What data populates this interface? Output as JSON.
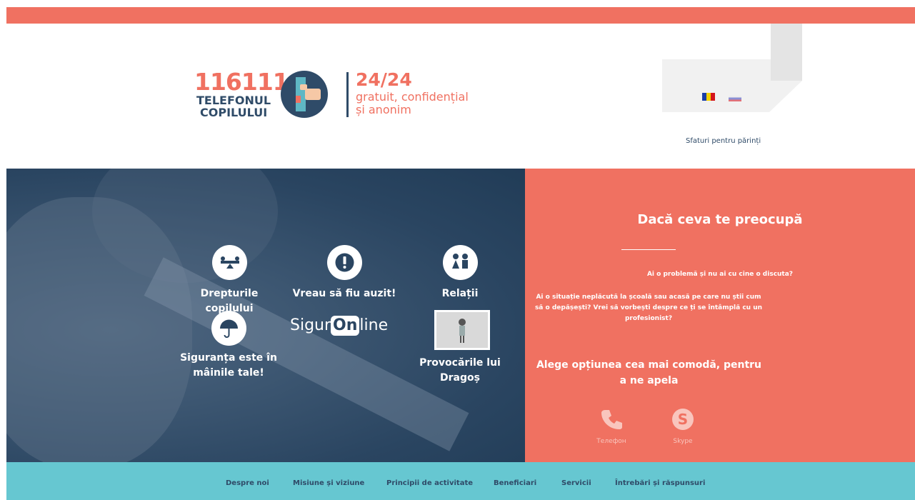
{
  "header": {
    "logo_number": "116111",
    "logo_line1": "TELEFONUL",
    "logo_line2": "COPILULUI",
    "tagline_hours": "24/24",
    "tagline_line1": "gratuit, confidențial",
    "tagline_line2": "și anonim",
    "parents_link": "Sfaturi pentru părinți",
    "languages": [
      "flag-ro-icon",
      "flag-ru-icon"
    ]
  },
  "hero": {
    "tiles": [
      {
        "label": "Drepturile copilului",
        "icon": "seesaw-icon"
      },
      {
        "label": "Vreau să fiu auzit!",
        "icon": "exclamation-icon"
      },
      {
        "label": "Relații",
        "icon": "children-icon"
      },
      {
        "label": "Siguranța este în",
        "label2": "mâinile tale!",
        "icon": "umbrella-icon"
      },
      {
        "label": "Provocările lui",
        "label2": "Dragoș",
        "icon": "dragos-image"
      }
    ],
    "sigur_text_1": "Sigur",
    "sigur_text_2": "On",
    "sigur_text_3": "line"
  },
  "panel": {
    "title": "Dacă ceva te preocupă",
    "question1": "Ai o problemă și nu ai cu cine o discuta?",
    "question2": "Ai o situație neplăcută la școală sau acasă pe care nu știi cum să o depășești? Vrei să vorbești despre ce ți se întâmplă cu un profesionist?",
    "choose_text": "Alege opțiunea cea mai comodă, pentru a ne apela",
    "phone_label": "Телефон",
    "skype_label": "Skype",
    "colors": {
      "panel": "#f07161",
      "hero": "#2a4561",
      "nav": "#66c7d1",
      "text_dark": "#2f4b68"
    }
  },
  "nav": {
    "items": [
      "Despre noi",
      "Misiune și viziune",
      "Principii de activitate",
      "Beneficiari",
      "Servicii",
      "Întrebări și răspunsuri"
    ]
  }
}
